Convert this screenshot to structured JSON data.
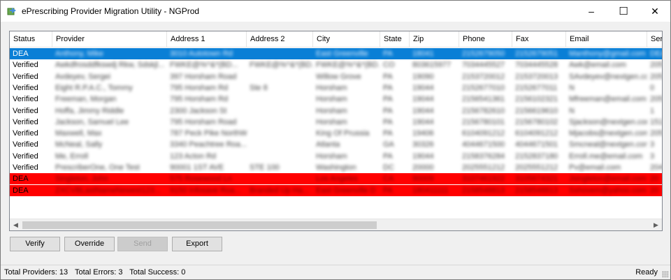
{
  "window": {
    "title": "ePrescribing Provider Migration Utility - NGProd",
    "minimize": "–",
    "maximize": "☐",
    "close": "✕"
  },
  "grid": {
    "columns": [
      "Status",
      "Provider",
      "Address 1",
      "Address 2",
      "City",
      "State",
      "Zip",
      "Phone",
      "Fax",
      "Email",
      "Ser"
    ],
    "rows": [
      {
        "kind": "selected",
        "cells": [
          "DEA",
          "Anthony, Mike",
          "3010 Autotown Rd",
          "",
          "East Greenville",
          "PA",
          "18041",
          "2152679050",
          "2152679051",
          "Manthony@gmail.com",
          "DEA"
        ]
      },
      {
        "kind": "normal",
        "cells": [
          "Verified",
          "Awkdfrosddfkswdj Rkw, Sdskjl...",
          "FWKE@%^&*(BD...",
          "FWKE@%^&*(BD...",
          "FWKE@%^&*(BD...",
          "CO",
          "803615977",
          "7034445527",
          "7034445528",
          "Awk@email.com",
          "205"
        ]
      },
      {
        "kind": "normal",
        "cells": [
          "Verified",
          "Avdeyev, Sergei",
          "397 Horsham Road",
          "",
          "Willow Grove",
          "PA",
          "19090",
          "2153720012",
          "2153720013",
          "SAvdeyev@nextgen.com",
          "205"
        ]
      },
      {
        "kind": "normal",
        "cells": [
          "Verified",
          "Eight R.P.A.C., Tommy",
          "795 Horsham Rd",
          "Ste 8",
          "Horsham",
          "PA",
          "19044",
          "2152677010",
          "2152677011",
          "N",
          "0"
        ]
      },
      {
        "kind": "normal",
        "cells": [
          "Verified",
          "Freeman, Morgan",
          "795 Horsham Rd",
          "",
          "Horsham",
          "PA",
          "19044",
          "2156541361",
          "2156102321",
          "Mfreeman@email.com",
          "205"
        ]
      },
      {
        "kind": "normal",
        "cells": [
          "Verified",
          "Hoffa, Jimmy Riddle",
          "2300 Jackson St",
          "",
          "Horsham",
          "PA",
          "19044",
          "2156782610",
          "2156619610",
          "N",
          "1"
        ]
      },
      {
        "kind": "normal",
        "cells": [
          "Verified",
          "Jackson, Samuel Lee",
          "795 Horsham Road",
          "",
          "Horsham",
          "PA",
          "19044",
          "2156780101",
          "2156780102",
          "Sjackson@nextgen.com",
          "151"
        ]
      },
      {
        "kind": "normal",
        "cells": [
          "Verified",
          "Maxwell, Max",
          "787 Peck Pike NorthW...",
          "",
          "King Of Prussia",
          "PA",
          "19406",
          "6104091212",
          "6104091212",
          "Mjacobs@nextgen.com",
          "205"
        ]
      },
      {
        "kind": "normal",
        "cells": [
          "Verified",
          "McNeal, Sally",
          "3340 Peachtree Roa...",
          "",
          "Atlanta",
          "GA",
          "30326",
          "4044671500",
          "4044671501",
          "Smcneal@nextgen.com",
          "3"
        ]
      },
      {
        "kind": "normal",
        "cells": [
          "Verified",
          "Me, Erroll",
          "123 Acton Rd",
          "",
          "Horsham",
          "PA",
          "19044",
          "2158376284",
          "2152837180",
          "Erroll.me@email.com",
          "3"
        ]
      },
      {
        "kind": "normal",
        "cells": [
          "Verified",
          "PrescriberOne, One Test",
          "90001 1ST AVE",
          "STE 100",
          "Washington",
          "DC",
          "20000",
          "2025551212",
          "2025551212",
          "Pv@email.com",
          "204"
        ]
      },
      {
        "kind": "error",
        "cells": [
          "DEA",
          "Singleton, John",
          "575 Rosewood Ln",
          "",
          "Los Angeles",
          "CA",
          "90009",
          "3107461922",
          "3105674321",
          "Jsingleton@email.com",
          "20"
        ]
      },
      {
        "kind": "error",
        "cells": [
          "DEA",
          "ZXCVBLastNameNewest123...",
          "9150 Infosave Roa...",
          "Branded Up Ha...",
          "East Greenville D",
          "PA",
          "180411111",
          "2158548813",
          "2158548813",
          "Sshovem@yahoo.com",
          "20"
        ]
      }
    ]
  },
  "buttons": {
    "verify": "Verify",
    "override": "Override",
    "send": "Send",
    "export": "Export"
  },
  "status": {
    "total_providers": "Total Providers: 13",
    "total_errors": "Total Errors: 3",
    "total_success": "Total Success: 0",
    "state": "Ready"
  },
  "colors": {
    "selected_row": "#0a7fd6",
    "error_row": "#ff0000",
    "window_bg": "#f0f0f0"
  }
}
